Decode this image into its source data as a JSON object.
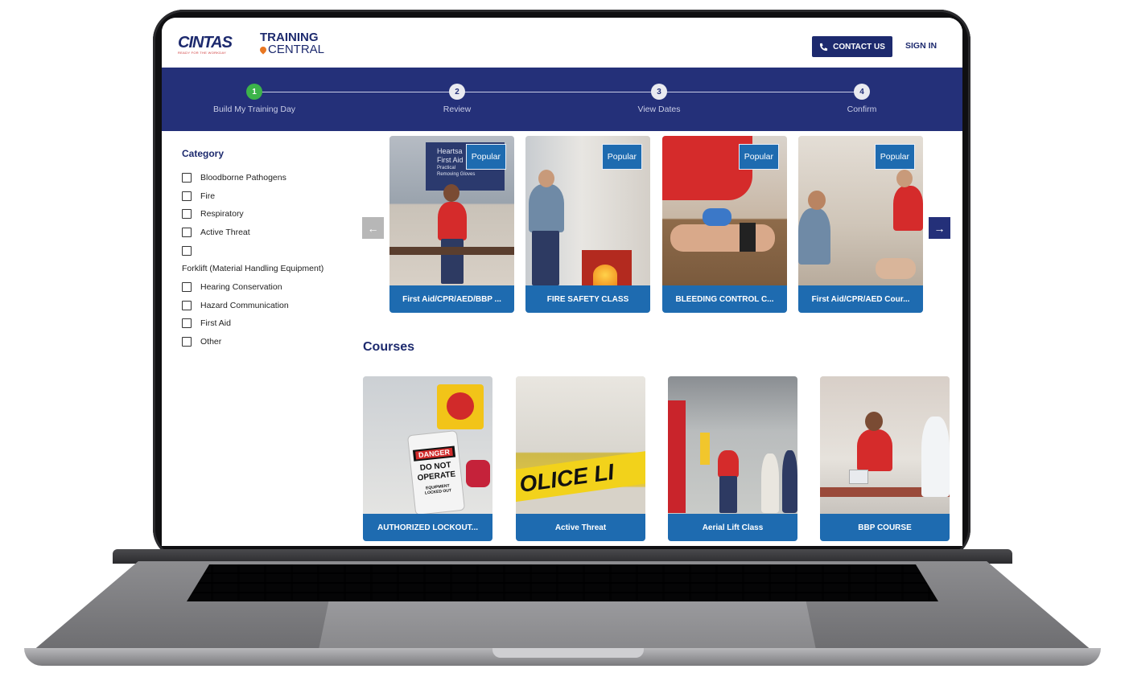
{
  "header": {
    "brand": "CINTAS",
    "brand_tagline": "READY FOR THE WORKDAY",
    "product_line1": "TRAINING",
    "product_line2": "CENTRAL",
    "contact_label": "CONTACT US",
    "signin_label": "SIGN IN"
  },
  "stepper": {
    "steps": [
      {
        "num": "1",
        "label": "Build My Training Day"
      },
      {
        "num": "2",
        "label": "Review"
      },
      {
        "num": "3",
        "label": "View Dates"
      },
      {
        "num": "4",
        "label": "Confirm"
      }
    ]
  },
  "sidebar": {
    "title": "Category",
    "items": [
      "Bloodborne Pathogens",
      "Fire",
      "Respiratory",
      "Active Threat",
      "",
      "Forklift (Material Handling Equipment)",
      "Hearing Conservation",
      "Hazard Communication",
      "First Aid",
      "Other"
    ]
  },
  "popular": {
    "badge": "Popular",
    "cards": [
      {
        "title": "First Aid/CPR/AED/BBP ...",
        "screen_text1": "Heartsa",
        "screen_text2": "First Aid",
        "screen_text3": "Practical",
        "screen_text4": "Removing Gloves"
      },
      {
        "title": "FIRE SAFETY CLASS"
      },
      {
        "title": "BLEEDING CONTROL C..."
      },
      {
        "title": "First Aid/CPR/AED Cour..."
      }
    ]
  },
  "courses": {
    "title": "Courses",
    "cards": [
      {
        "title": "AUTHORIZED LOCKOUT...",
        "tag_line1": "DANGER",
        "tag_line2": "DO NOT",
        "tag_line3": "OPERATE",
        "tag_line4": "EQUIPMENT",
        "tag_line5": "LOCKED OUT"
      },
      {
        "title": "Active Threat",
        "tape_text": "OLICE LI"
      },
      {
        "title": "Aerial Lift Class"
      },
      {
        "title": "BBP COURSE"
      }
    ]
  },
  "colors": {
    "navy": "#243079",
    "card_blue": "#1e6bb0",
    "step_active": "#3cb34a"
  }
}
